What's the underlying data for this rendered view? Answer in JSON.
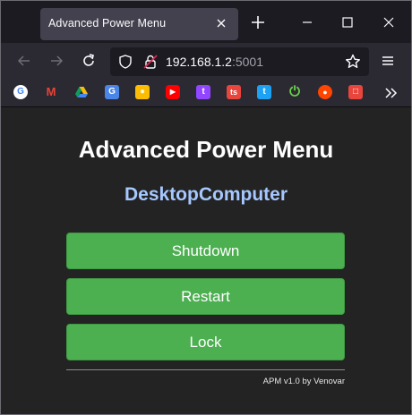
{
  "browser": {
    "tab_title": "Advanced Power Menu",
    "url_host": "192.168.1.2",
    "url_port": ":5001"
  },
  "bookmarks": [
    {
      "icon": "google-icon",
      "glyph": "G",
      "color": "#ffffff"
    },
    {
      "icon": "gmail-icon",
      "glyph": "M",
      "color": "#ffffff"
    },
    {
      "icon": "drive-icon",
      "glyph": "▲",
      "color": "#2b2a33"
    },
    {
      "icon": "translate-icon",
      "glyph": "G",
      "color": "#4a86e8"
    },
    {
      "icon": "keep-icon",
      "glyph": "●",
      "color": "#fbbc04"
    },
    {
      "icon": "youtube-icon",
      "glyph": "▶",
      "color": "#ff0000"
    },
    {
      "icon": "twitch-icon",
      "glyph": "t",
      "color": "#9146ff"
    },
    {
      "icon": "ts-icon",
      "glyph": "ts",
      "color": "#e8453c"
    },
    {
      "icon": "twitter-icon",
      "glyph": "t",
      "color": "#1da1f2"
    },
    {
      "icon": "power-icon",
      "glyph": "⏻",
      "color": "#2b2a33"
    },
    {
      "icon": "reddit-icon",
      "glyph": "●",
      "color": "#ff4500"
    },
    {
      "icon": "bookmark-icon",
      "glyph": "□",
      "color": "#e8453c"
    }
  ],
  "app": {
    "title": "Advanced Power Menu",
    "device_name": "DesktopComputer",
    "buttons": {
      "shutdown": "Shutdown",
      "restart": "Restart",
      "lock": "Lock"
    },
    "footer": "APM v1.0 by Venovar"
  },
  "colors": {
    "button_green": "#4caf50",
    "device_blue": "#a6c8ff",
    "page_bg": "#232323"
  }
}
